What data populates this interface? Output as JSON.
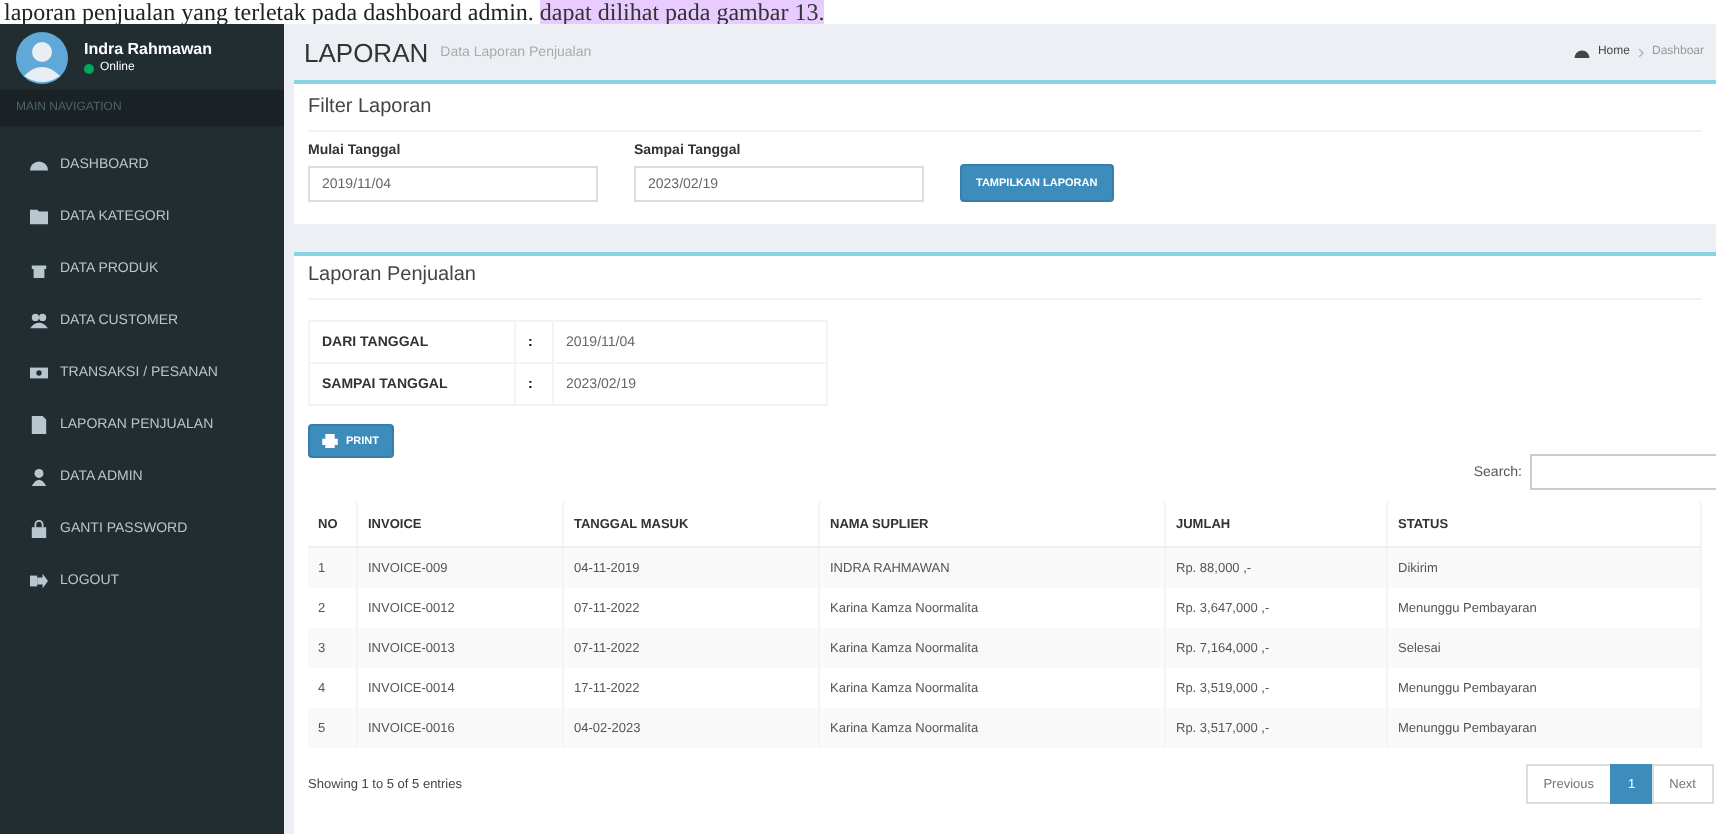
{
  "document_caption": {
    "text": "laporan penjualan yang terletak pada dashboard admin.",
    "highlight": "dapat dilihat pada gambar 13."
  },
  "sidebar": {
    "user": {
      "name": "Indra Rahmawan",
      "status": "Online"
    },
    "section": "MAIN NAVIGATION",
    "items": [
      {
        "label": "DASHBOARD",
        "kind": "dashboard",
        "selected": false
      },
      {
        "label": "DATA KATEGORI",
        "kind": "category",
        "selected": false
      },
      {
        "label": "DATA PRODUK",
        "kind": "product",
        "selected": false
      },
      {
        "label": "DATA CUSTOMER",
        "kind": "customer",
        "selected": false
      },
      {
        "label": "TRANSAKSI / PESANAN",
        "kind": "transaction",
        "selected": false
      },
      {
        "label": "LAPORAN PENJUALAN",
        "kind": "report",
        "selected": false
      },
      {
        "label": "DATA ADMIN",
        "kind": "admin",
        "selected": false
      },
      {
        "label": "GANTI PASSWORD",
        "kind": "password",
        "selected": false
      },
      {
        "label": "LOGOUT",
        "kind": "logout",
        "selected": false
      }
    ]
  },
  "header": {
    "title": "LAPORAN",
    "subtitle": "Data Laporan Penjualan",
    "breadcrumb": [
      "Home",
      "Dashboar"
    ]
  },
  "filter": {
    "title": "Filter Laporan",
    "fields": [
      {
        "label": "Mulai Tanggal",
        "value": "2019/11/04"
      },
      {
        "label": "Sampai Tanggal",
        "value": "2023/02/19"
      }
    ],
    "button": "TAMPILKAN LAPORAN"
  },
  "report": {
    "title": "Laporan Penjualan",
    "info": [
      {
        "label": "DARI TANGGAL",
        "sep": ":",
        "value": "2019/11/04"
      },
      {
        "label": "SAMPAI TANGGAL",
        "sep": ":",
        "value": "2023/02/19"
      }
    ],
    "print_button": "PRINT",
    "search_label": "Search:",
    "table": {
      "columns": [
        "NO",
        "INVOICE",
        "TANGGAL MASUK",
        "NAMA SUPLIER",
        "JUMLAH",
        "STATUS"
      ],
      "rows": [
        [
          "1",
          "INVOICE-009",
          "04-11-2019",
          "INDRA RAHMAWAN",
          "Rp. 88,000 ,-",
          "Dikirim"
        ],
        [
          "2",
          "INVOICE-0012",
          "07-11-2022",
          "Karina Kamza Noormalita",
          "Rp. 3,647,000 ,-",
          "Menunggu Pembayaran"
        ],
        [
          "3",
          "INVOICE-0013",
          "07-11-2022",
          "Karina Kamza Noormalita",
          "Rp. 7,164,000 ,-",
          "Selesai"
        ],
        [
          "4",
          "INVOICE-0014",
          "17-11-2022",
          "Karina Kamza Noormalita",
          "Rp. 3,519,000 ,-",
          "Menunggu Pembayaran"
        ],
        [
          "5",
          "INVOICE-0016",
          "04-02-2023",
          "Karina Kamza Noormalita",
          "Rp. 3,517,000 ,-",
          "Menunggu Pembayaran"
        ]
      ]
    },
    "entries_info": "Showing 1 to 5 of 5 entries",
    "pagination": [
      {
        "label": "Previous",
        "selected": false
      },
      {
        "label": "1",
        "selected": true
      },
      {
        "label": "Next",
        "selected": false
      }
    ]
  }
}
